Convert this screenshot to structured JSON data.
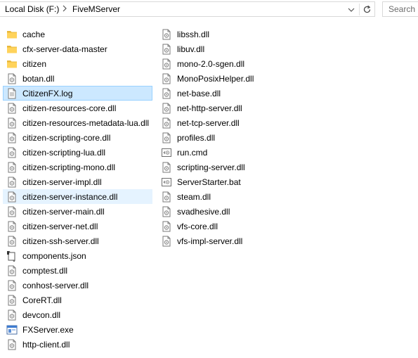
{
  "address_bar": {
    "breadcrumbs": [
      {
        "label": "Local Disk (F:)"
      },
      {
        "label": "FiveMServer"
      }
    ],
    "separator_icon": "chevron-right-icon",
    "dropdown_icon": "chevron-down-icon",
    "refresh_icon": "refresh-icon"
  },
  "search": {
    "placeholder": "Search FiveMServer"
  },
  "files": {
    "column1": [
      {
        "name": "cache",
        "icon": "folder-icon"
      },
      {
        "name": "cfx-server-data-master",
        "icon": "folder-icon"
      },
      {
        "name": "citizen",
        "icon": "folder-icon"
      },
      {
        "name": "botan.dll",
        "icon": "dll-file-icon"
      },
      {
        "name": "CitizenFX.log",
        "icon": "text-file-icon",
        "state": "focused"
      },
      {
        "name": "citizen-resources-core.dll",
        "icon": "dll-file-icon"
      },
      {
        "name": "citizen-resources-metadata-lua.dll",
        "icon": "dll-file-icon"
      },
      {
        "name": "citizen-scripting-core.dll",
        "icon": "dll-file-icon"
      },
      {
        "name": "citizen-scripting-lua.dll",
        "icon": "dll-file-icon"
      },
      {
        "name": "citizen-scripting-mono.dll",
        "icon": "dll-file-icon"
      },
      {
        "name": "citizen-server-impl.dll",
        "icon": "dll-file-icon"
      },
      {
        "name": "citizen-server-instance.dll",
        "icon": "dll-file-icon",
        "state": "selected"
      },
      {
        "name": "citizen-server-main.dll",
        "icon": "dll-file-icon"
      },
      {
        "name": "citizen-server-net.dll",
        "icon": "dll-file-icon"
      },
      {
        "name": "citizen-ssh-server.dll",
        "icon": "dll-file-icon"
      },
      {
        "name": "components.json",
        "icon": "json-file-icon"
      },
      {
        "name": "comptest.dll",
        "icon": "dll-file-icon"
      },
      {
        "name": "conhost-server.dll",
        "icon": "dll-file-icon"
      },
      {
        "name": "CoreRT.dll",
        "icon": "dll-file-icon"
      },
      {
        "name": "devcon.dll",
        "icon": "dll-file-icon"
      },
      {
        "name": "FXServer.exe",
        "icon": "exe-file-icon"
      },
      {
        "name": "http-client.dll",
        "icon": "dll-file-icon"
      }
    ],
    "column2": [
      {
        "name": "libssh.dll",
        "icon": "dll-file-icon"
      },
      {
        "name": "libuv.dll",
        "icon": "dll-file-icon"
      },
      {
        "name": "mono-2.0-sgen.dll",
        "icon": "dll-file-icon"
      },
      {
        "name": "MonoPosixHelper.dll",
        "icon": "dll-file-icon"
      },
      {
        "name": "net-base.dll",
        "icon": "dll-file-icon"
      },
      {
        "name": "net-http-server.dll",
        "icon": "dll-file-icon"
      },
      {
        "name": "net-tcp-server.dll",
        "icon": "dll-file-icon"
      },
      {
        "name": "profiles.dll",
        "icon": "dll-file-icon"
      },
      {
        "name": "run.cmd",
        "icon": "cmd-file-icon"
      },
      {
        "name": "scripting-server.dll",
        "icon": "dll-file-icon"
      },
      {
        "name": "ServerStarter.bat",
        "icon": "bat-file-icon"
      },
      {
        "name": "steam.dll",
        "icon": "dll-file-icon"
      },
      {
        "name": "svadhesive.dll",
        "icon": "dll-file-icon"
      },
      {
        "name": "vfs-core.dll",
        "icon": "dll-file-icon"
      },
      {
        "name": "vfs-impl-server.dll",
        "icon": "dll-file-icon"
      }
    ]
  },
  "colors": {
    "folder": "#ffd35b",
    "folder_dark": "#e8b83a",
    "selection": "#e5f3ff",
    "focus": "#cce8ff",
    "focus_border": "#99d1ff"
  }
}
